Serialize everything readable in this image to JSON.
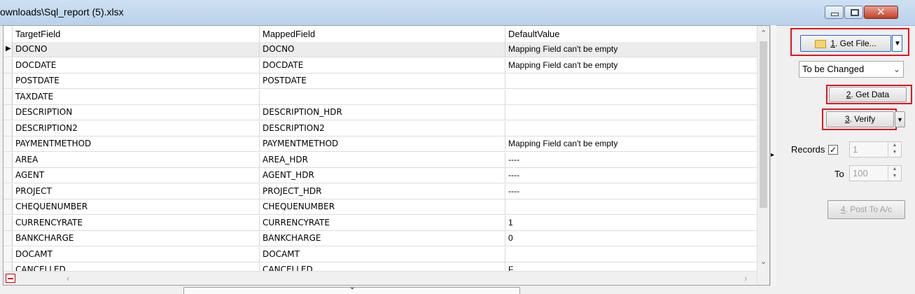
{
  "window": {
    "title": "ownloads\\Sql_report (5).xlsx",
    "minimize_glyph": "",
    "maximize_glyph": "",
    "close_glyph": "✕"
  },
  "grid": {
    "columns": [
      "TargetField",
      "MappedField",
      "DefaultValue"
    ],
    "selected_row": 0,
    "rows": [
      {
        "target": "DOCNO",
        "mapped": "DOCNO",
        "default": "Mapping Field can't be empty"
      },
      {
        "target": "DOCDATE",
        "mapped": "DOCDATE",
        "default": "Mapping Field can't be empty"
      },
      {
        "target": "POSTDATE",
        "mapped": "POSTDATE",
        "default": ""
      },
      {
        "target": "TAXDATE",
        "mapped": "",
        "default": ""
      },
      {
        "target": "DESCRIPTION",
        "mapped": "DESCRIPTION_HDR",
        "default": ""
      },
      {
        "target": "DESCRIPTION2",
        "mapped": "DESCRIPTION2",
        "default": ""
      },
      {
        "target": "PAYMENTMETHOD",
        "mapped": "PAYMENTMETHOD",
        "default": "Mapping Field can't be empty"
      },
      {
        "target": "AREA",
        "mapped": "AREA_HDR",
        "default": "----"
      },
      {
        "target": "AGENT",
        "mapped": "AGENT_HDR",
        "default": "----"
      },
      {
        "target": "PROJECT",
        "mapped": "PROJECT_HDR",
        "default": "----"
      },
      {
        "target": "CHEQUENUMBER",
        "mapped": "CHEQUENUMBER",
        "default": ""
      },
      {
        "target": "CURRENCYRATE",
        "mapped": "CURRENCYRATE",
        "default": "1"
      },
      {
        "target": "BANKCHARGE",
        "mapped": "BANKCHARGE",
        "default": "0"
      },
      {
        "target": "DOCAMT",
        "mapped": "DOCAMT",
        "default": ""
      },
      {
        "target": "CANCELLED",
        "mapped": "CANCELLED",
        "default": "F"
      }
    ]
  },
  "panel": {
    "get_file_prefix": "1",
    "get_file_label": ". Get File...",
    "combo_value": "To be Changed",
    "get_data_prefix": "2",
    "get_data_label": ". Get Data",
    "verify_prefix": "3",
    "verify_label": ". Verify",
    "records_label": "Records",
    "records_checked": "✓",
    "from_value": "1",
    "to_label": "To",
    "to_value": "100",
    "post_prefix": "4",
    "post_label": ". Post To A/c"
  },
  "colors": {
    "highlight_box": "#e0151f",
    "dropdown_accent": "#1f64c8"
  }
}
